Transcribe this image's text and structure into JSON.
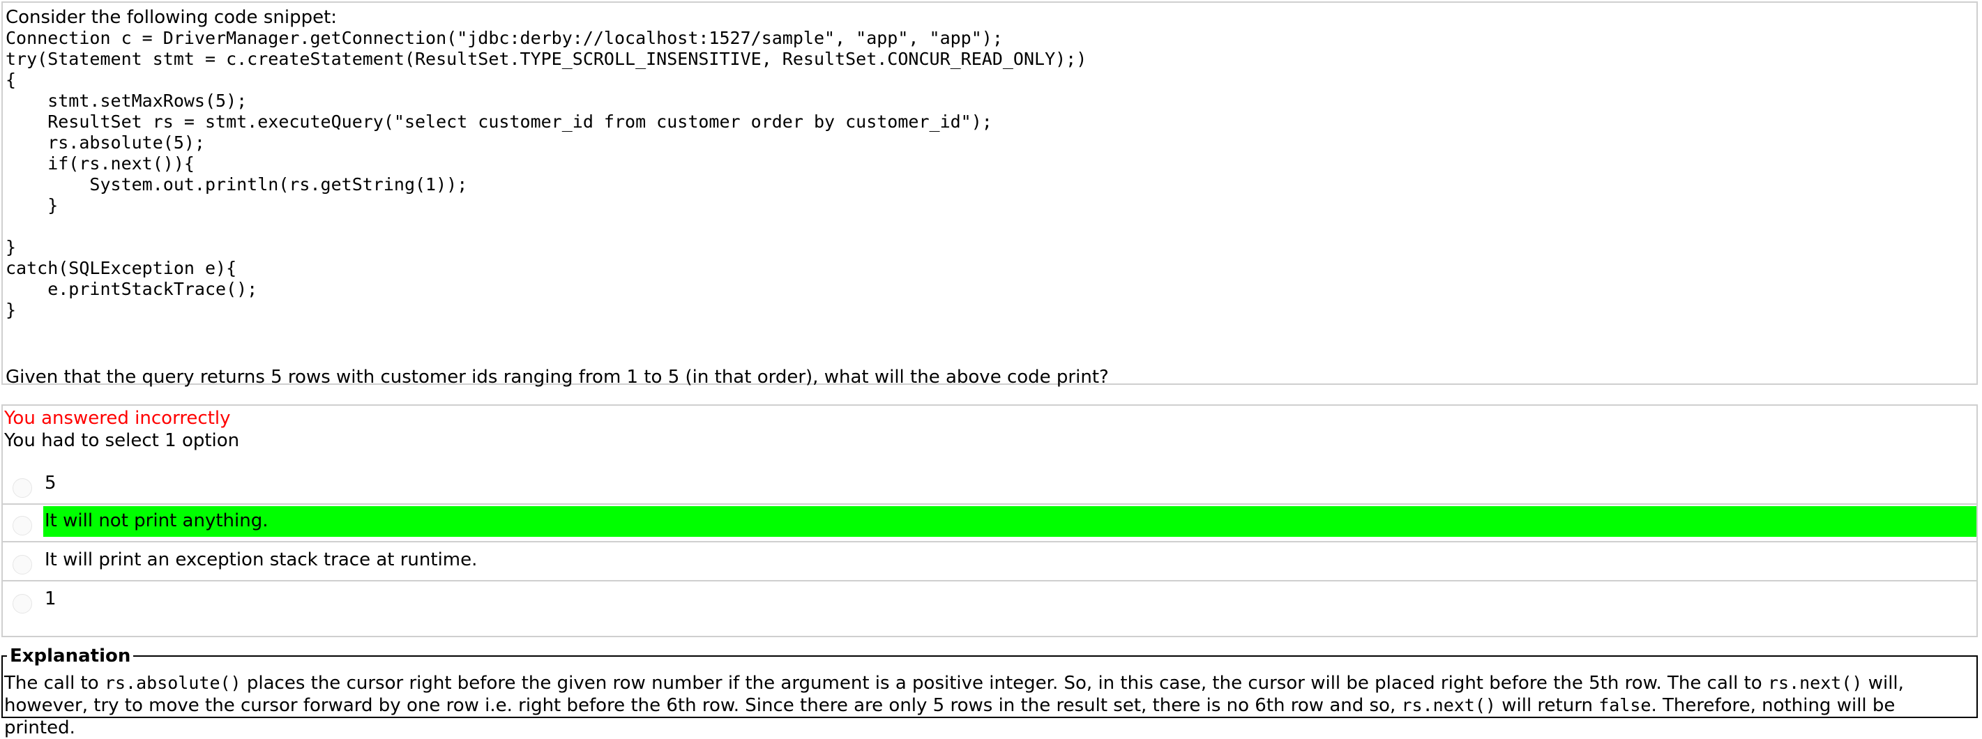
{
  "question": {
    "intro": "Consider the following code snippet:",
    "code_lines": [
      "Connection c = DriverManager.getConnection(\"jdbc:derby://localhost:1527/sample\", \"app\", \"app\");",
      "try(Statement stmt = c.createStatement(ResultSet.TYPE_SCROLL_INSENSITIVE, ResultSet.CONCUR_READ_ONLY);)",
      "{",
      "    stmt.setMaxRows(5);",
      "    ResultSet rs = stmt.executeQuery(\"select customer_id from customer order by customer_id\");",
      "    rs.absolute(5);",
      "    if(rs.next()){",
      "        System.out.println(rs.getString(1));",
      "    }",
      "",
      "}",
      "catch(SQLException e){",
      "    e.printStackTrace();",
      "}"
    ],
    "prompt": "Given that the query returns 5 rows with customer ids ranging from 1 to 5 (in that order), what will the above code print?"
  },
  "answer": {
    "result": "You answered incorrectly",
    "instruction": "You had to select 1 option",
    "options": [
      {
        "label": "5",
        "correct": false
      },
      {
        "label": "It will not print anything.",
        "correct": true
      },
      {
        "label": "It will print an exception stack trace at runtime.",
        "correct": false
      },
      {
        "label": "1",
        "correct": false
      }
    ]
  },
  "explanation": {
    "legend": "Explanation",
    "parts": [
      {
        "text": "The call to ",
        "code": false
      },
      {
        "text": "rs.absolute()",
        "code": true
      },
      {
        "text": " places the cursor right before the given row number if the argument is a positive integer. So, in this case, the cursor will be placed right before the 5th row. The call to ",
        "code": false
      },
      {
        "text": "rs.next()",
        "code": true
      },
      {
        "text": " will, however, try to move the cursor forward by one row i.e. right before the 6th row. Since there are only 5 rows in the result set, there is no 6th row and so, ",
        "code": false
      },
      {
        "text": "rs.next()",
        "code": true
      },
      {
        "text": " will return ",
        "code": false
      },
      {
        "text": "false",
        "code": true
      },
      {
        "text": ". Therefore, nothing will be printed.",
        "code": false
      }
    ]
  },
  "colors": {
    "correct_highlight": "#00ff00",
    "incorrect_text": "#ff0000",
    "border": "#cfcfcf"
  }
}
